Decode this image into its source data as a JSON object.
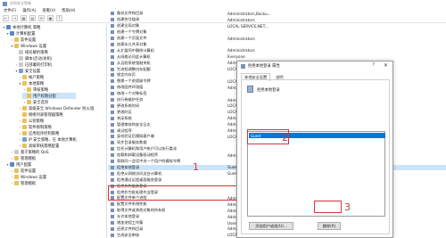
{
  "window": {
    "title": "本地安全策略"
  },
  "menu": [
    "文件(F)",
    "操作(A)",
    "查看(V)",
    "帮助(H)"
  ],
  "toolbar": [
    "←",
    "→",
    "▦",
    "▤",
    "⟳",
    "▣",
    "?"
  ],
  "tree": [
    {
      "label": "本地计算机 策略",
      "toggle": "▾",
      "icon": "pc"
    },
    {
      "label": "计算机配置",
      "toggle": "▾",
      "icon": "pc"
    },
    {
      "label": "软件设置",
      "toggle": "›",
      "icon": "folder"
    },
    {
      "label": "Windows 设置",
      "toggle": "▾",
      "icon": "folder"
    },
    {
      "label": "域名解析策略",
      "toggle": "",
      "icon": "doc"
    },
    {
      "label": "脚本(启动/关机)",
      "toggle": "",
      "icon": "doc"
    },
    {
      "label": "已部署的打印机",
      "toggle": "›",
      "icon": "doc"
    },
    {
      "label": "安全设置",
      "toggle": "▾",
      "icon": "shield"
    },
    {
      "label": "帐户策略",
      "toggle": "›",
      "icon": "folder"
    },
    {
      "label": "本地策略",
      "toggle": "▾",
      "icon": "folder"
    },
    {
      "label": "审核策略",
      "toggle": "›",
      "icon": "folder"
    },
    {
      "label": "用户权限分配",
      "toggle": "",
      "icon": "folder"
    },
    {
      "label": "安全选项",
      "toggle": "›",
      "icon": "folder"
    },
    {
      "label": "高级安全 Windows Defender 防火墙",
      "toggle": "›",
      "icon": "folder"
    },
    {
      "label": "网络列表管理器策略",
      "toggle": "",
      "icon": "folder"
    },
    {
      "label": "公钥策略",
      "toggle": "›",
      "icon": "folder"
    },
    {
      "label": "软件限制策略",
      "toggle": "›",
      "icon": "folder"
    },
    {
      "label": "应用程序控制策略",
      "toggle": "›",
      "icon": "folder"
    },
    {
      "label": "IP 安全策略，在 本地计算机",
      "toggle": "›",
      "icon": "shield"
    },
    {
      "label": "高级审核策略配置",
      "toggle": "›",
      "icon": "folder"
    },
    {
      "label": "基于策略的 QoS",
      "toggle": "›",
      "icon": "doc"
    },
    {
      "label": "管理模板",
      "toggle": "›",
      "icon": "folder"
    },
    {
      "label": "用户配置",
      "toggle": "▾",
      "icon": "pc"
    },
    {
      "label": "软件设置",
      "toggle": "›",
      "icon": "folder"
    },
    {
      "label": "Windows 设置",
      "toggle": "›",
      "icon": "folder"
    },
    {
      "label": "管理模板",
      "toggle": "›",
      "icon": "folder"
    }
  ],
  "policies": [
    {
      "policy": "备份文件和目录",
      "setting": "Administrators,Backu..."
    },
    {
      "policy": "创建符号链接",
      "setting": "Administrators"
    },
    {
      "policy": "创建全局对象",
      "setting": "LOCAL SERVICE,NET..."
    },
    {
      "policy": "创建一个令牌对象",
      "setting": ""
    },
    {
      "policy": "创建一个页面文件",
      "setting": "Administrators"
    },
    {
      "policy": "创建永久共享对象",
      "setting": ""
    },
    {
      "policy": "从扩展坞中删除计算机",
      "setting": "Administrators"
    },
    {
      "policy": "从网络访问此计算机",
      "setting": "Everyone"
    },
    {
      "policy": "从远程系统强制关机",
      "setting": "Administrators"
    },
    {
      "policy": "为进程调整内存配额",
      "setting": "LOCAL"
    },
    {
      "policy": "锁定内存页",
      "setting": ""
    },
    {
      "policy": "替换一个进程级令牌",
      "setting": "LOCAL"
    },
    {
      "policy": "修改固件环境值",
      "setting": "Admin"
    },
    {
      "policy": "修改一个对象标签",
      "setting": ""
    },
    {
      "policy": "执行卷维护任务",
      "setting": "Admin"
    },
    {
      "policy": "更改系统时间",
      "setting": "LOCAL"
    },
    {
      "policy": "更改时区",
      "setting": "LOCAL"
    },
    {
      "policy": "关闭系统",
      "setting": "Admin"
    },
    {
      "policy": "管理审核和安全日志",
      "setting": "Admin"
    },
    {
      "policy": "调试程序",
      "setting": "Admin"
    },
    {
      "policy": "身份验证后模拟客户端",
      "setting": "LOCAL"
    },
    {
      "policy": "同步目录服务数据",
      "setting": ""
    },
    {
      "policy": "信任计算机和用户帐户可以执行委派",
      "setting": ""
    },
    {
      "policy": "加载和卸载设备驱动程序",
      "setting": "Admin"
    },
    {
      "policy": "获取同一会话中另一个用户的模拟令牌",
      "setting": ""
    },
    {
      "policy": "拒绝本地登录",
      "setting": "Guest"
    },
    {
      "policy": "拒绝从网络访问这台计算机",
      "setting": "Guest"
    },
    {
      "policy": "拒绝通过远程桌面服务登录",
      "setting": ""
    },
    {
      "policy": "拒绝作为服务登录",
      "setting": ""
    },
    {
      "policy": "拒绝作为批处理作业登录",
      "setting": ""
    },
    {
      "policy": "配置文件单个进程",
      "setting": "Admin"
    },
    {
      "policy": "配置文件系统性能",
      "setting": "Admin"
    },
    {
      "policy": "取得文件或其他对象的所有权",
      "setting": "Admin"
    },
    {
      "policy": "允许本地登录",
      "setting": "Admin"
    },
    {
      "policy": "增加进程工作集",
      "setting": "Users"
    },
    {
      "policy": "还原文件和目录",
      "setting": "Admin"
    },
    {
      "policy": "生成安全审核",
      "setting": "LOCAL"
    }
  ],
  "dialog": {
    "title": "拒绝本地登录 属性",
    "help": "?",
    "close": "✕",
    "tabs": [
      "本地安全设置",
      "说明"
    ],
    "policy_name": "拒绝本地登录",
    "accounts": [
      "Guest"
    ],
    "add_button": "添加用户或组(U)...",
    "remove_button": "删除(R)"
  },
  "callouts": [
    "1",
    "2",
    "3"
  ],
  "colors": {
    "accent": "#0078d7",
    "annotation": "#d9323a",
    "selection": "#cce4f7"
  }
}
